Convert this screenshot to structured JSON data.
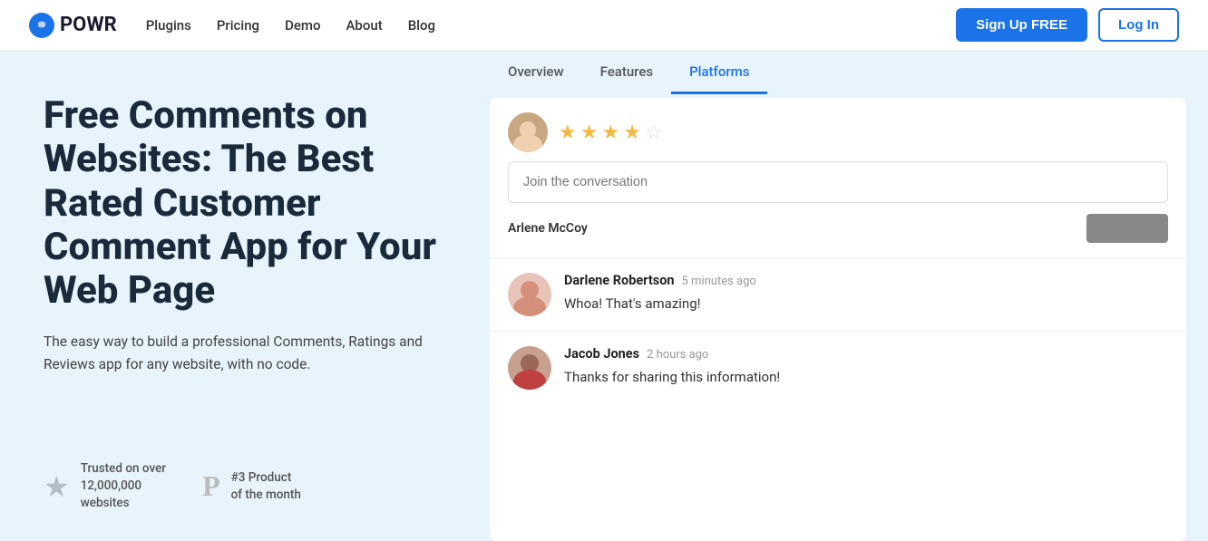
{
  "navbar": {
    "logo_text": "POWR",
    "nav_links": [
      {
        "id": "plugins",
        "label": "Plugins"
      },
      {
        "id": "pricing",
        "label": "Pricing"
      },
      {
        "id": "demo",
        "label": "Demo"
      },
      {
        "id": "about",
        "label": "About"
      },
      {
        "id": "blog",
        "label": "Blog"
      }
    ],
    "signup_label": "Sign Up FREE",
    "login_label": "Log In"
  },
  "sub_nav": {
    "items": [
      {
        "id": "overview",
        "label": "Overview",
        "active": false
      },
      {
        "id": "features",
        "label": "Features",
        "active": false
      },
      {
        "id": "platforms",
        "label": "Platforms",
        "active": true
      }
    ]
  },
  "hero": {
    "title": "Free Comments on Websites: The Best Rated Customer Comment App for Your Web Page",
    "subtitle": "The easy way to build a professional Comments, Ratings and Reviews app for any website, with no code.",
    "stats": [
      {
        "icon": "★",
        "line1": "Trusted on over",
        "line2": "12,000,000",
        "line3": "websites"
      },
      {
        "icon": "P",
        "line1": "#3 Product",
        "line2": "of the month"
      }
    ]
  },
  "compose": {
    "stars": [
      {
        "filled": true
      },
      {
        "filled": true
      },
      {
        "filled": true
      },
      {
        "filled": true
      },
      {
        "filled": false
      }
    ],
    "placeholder": "Join the conversation",
    "author": "Arlene McCoy",
    "submit_label": ""
  },
  "comments": [
    {
      "id": "comment-1",
      "author": "Darlene Robertson",
      "time": "5 minutes ago",
      "text": "Whoa! That's amazing!",
      "avatar_type": "darlene"
    },
    {
      "id": "comment-2",
      "author": "Jacob Jones",
      "time": "2 hours ago",
      "text": "Thanks for sharing this information!",
      "avatar_type": "jacob"
    }
  ]
}
